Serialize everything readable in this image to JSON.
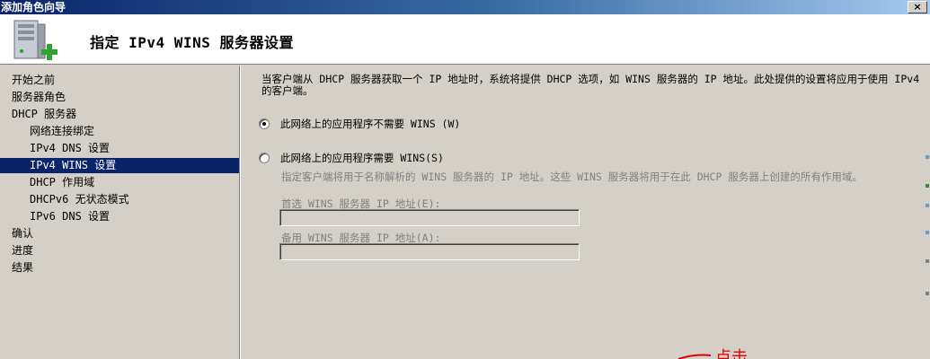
{
  "window": {
    "title": "添加角色向导",
    "close_label": "×"
  },
  "header": {
    "title": "指定 IPv4 WINS 服务器设置",
    "icon": "server-add-icon"
  },
  "sidebar": {
    "items": [
      {
        "label": "开始之前"
      },
      {
        "label": "服务器角色"
      },
      {
        "label": "DHCP 服务器"
      },
      {
        "label": "网络连接绑定"
      },
      {
        "label": "IPv4 DNS 设置"
      },
      {
        "label": "IPv4 WINS 设置"
      },
      {
        "label": "DHCP 作用域"
      },
      {
        "label": "DHCPv6 无状态模式"
      },
      {
        "label": "IPv6 DNS 设置"
      },
      {
        "label": "确认"
      },
      {
        "label": "进度"
      },
      {
        "label": "结果"
      }
    ],
    "selected": "IPv4 WINS 设置"
  },
  "content": {
    "description": "当客户端从 DHCP 服务器获取一个 IP 地址时，系统将提供 DHCP 选项，如 WINS 服务器的 IP 地址。此处提供的设置将应用于使用 IPv4 的客户端。",
    "option_not_required": "此网络上的应用程序不需要 WINS (W)",
    "option_required": "此网络上的应用程序需要 WINS(S)",
    "option_not_required_checked": true,
    "hint": "指定客户端将用于名称解析的 WINS 服务器的 IP 地址。这些 WINS 服务器将用于在此 DHCP 服务器上创建的所有作用域。",
    "preferred_label": "首选 WINS 服务器 IP 地址(E):",
    "preferred_value": "",
    "alternate_label": "备用 WINS 服务器 IP 地址(A):",
    "alternate_value": ""
  },
  "annotation": {
    "text": "点击",
    "color": "#e00000"
  },
  "colors": {
    "selection": "#0a246a",
    "face": "#d4d0c8",
    "disabled_text": "#808080"
  }
}
